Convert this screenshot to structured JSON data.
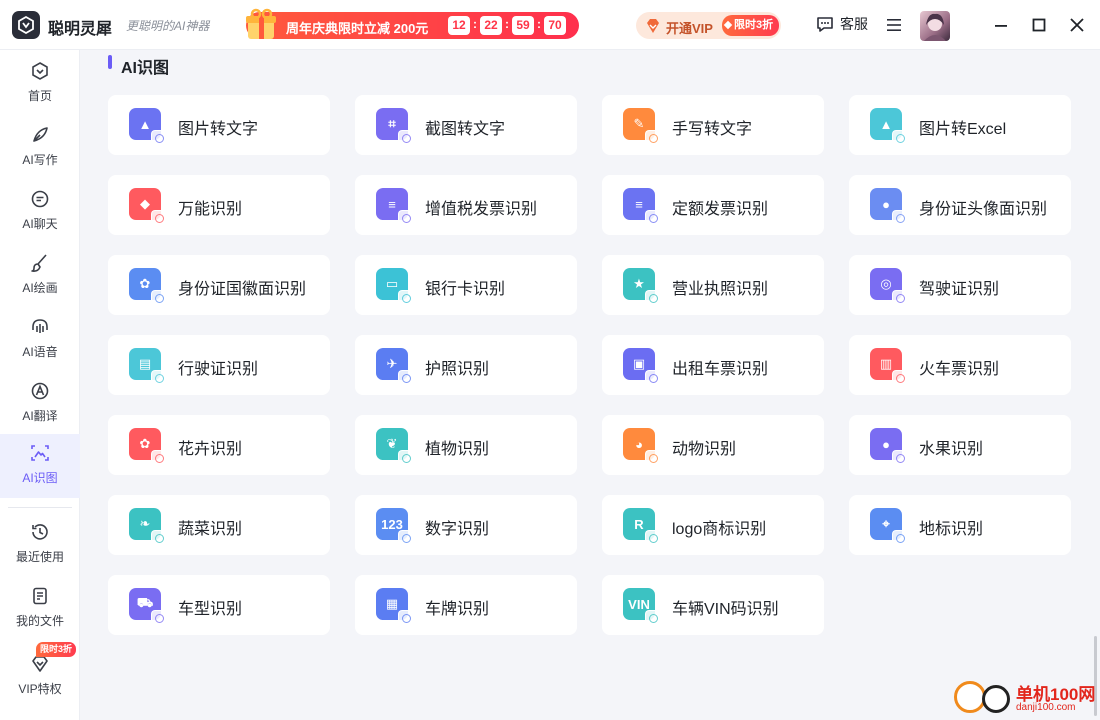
{
  "header": {
    "app_name": "聪明灵犀",
    "slogan": "更聪明的AI神器",
    "promo_text": "周年庆典限时立减 200元",
    "countdown": [
      "12",
      "22",
      "59",
      "70"
    ],
    "vip_label": "开通VIP",
    "vip_badge": "限时3折",
    "service_label": "客服"
  },
  "sidebar": {
    "items": [
      {
        "label": "首页",
        "icon": "home-icon"
      },
      {
        "label": "AI写作",
        "icon": "pen-icon"
      },
      {
        "label": "AI聊天",
        "icon": "chat-icon"
      },
      {
        "label": "AI绘画",
        "icon": "brush-icon"
      },
      {
        "label": "AI语音",
        "icon": "headphones-icon"
      },
      {
        "label": "AI翻译",
        "icon": "translate-icon"
      },
      {
        "label": "AI识图",
        "icon": "image-scan-icon",
        "active": true
      },
      {
        "label": "最近使用",
        "icon": "history-icon"
      },
      {
        "label": "我的文件",
        "icon": "file-icon"
      },
      {
        "label": "VIP特权",
        "icon": "diamond-icon"
      }
    ],
    "vip_badge": "限时3折"
  },
  "main": {
    "section_title": "AI识图",
    "tools": [
      {
        "label": "图片转文字",
        "icon": "image-to-text-icon",
        "color": "#6b73f2",
        "glyph": "▲"
      },
      {
        "label": "截图转文字",
        "icon": "screenshot-to-text-icon",
        "color": "#7a6df2",
        "glyph": "⌗"
      },
      {
        "label": "手写转文字",
        "icon": "handwriting-icon",
        "color": "#ff8a3d",
        "glyph": "✎"
      },
      {
        "label": "图片转Excel",
        "icon": "image-to-excel-icon",
        "color": "#4cc7d8",
        "glyph": "▲"
      },
      {
        "label": "万能识别",
        "icon": "universal-recognition-icon",
        "color": "#ff5a5f",
        "glyph": "◆"
      },
      {
        "label": "增值税发票识别",
        "icon": "vat-invoice-icon",
        "color": "#7a6df2",
        "glyph": "≡"
      },
      {
        "label": "定额发票识别",
        "icon": "quota-invoice-icon",
        "color": "#6b73f2",
        "glyph": "≡"
      },
      {
        "label": "身份证头像面识别",
        "icon": "id-card-photo-icon",
        "color": "#6b8df2",
        "glyph": "●"
      },
      {
        "label": "身份证国徽面识别",
        "icon": "id-card-emblem-icon",
        "color": "#5b8df2",
        "glyph": "✿"
      },
      {
        "label": "银行卡识别",
        "icon": "bank-card-icon",
        "color": "#3cc2d6",
        "glyph": "▭"
      },
      {
        "label": "营业执照识别",
        "icon": "business-license-icon",
        "color": "#3cc2c2",
        "glyph": "★"
      },
      {
        "label": "驾驶证识别",
        "icon": "driver-license-icon",
        "color": "#7a6df2",
        "glyph": "◎"
      },
      {
        "label": "行驶证识别",
        "icon": "vehicle-license-icon",
        "color": "#4cc7d8",
        "glyph": "▤"
      },
      {
        "label": "护照识别",
        "icon": "passport-icon",
        "color": "#5b7df2",
        "glyph": "✈"
      },
      {
        "label": "出租车票识别",
        "icon": "taxi-ticket-icon",
        "color": "#6b6df2",
        "glyph": "▣"
      },
      {
        "label": "火车票识别",
        "icon": "train-ticket-icon",
        "color": "#ff5a5f",
        "glyph": "▥"
      },
      {
        "label": "花卉识别",
        "icon": "flower-icon",
        "color": "#ff5a5f",
        "glyph": "✿"
      },
      {
        "label": "植物识别",
        "icon": "plant-icon",
        "color": "#3cc2c2",
        "glyph": "❦"
      },
      {
        "label": "动物识别",
        "icon": "animal-icon",
        "color": "#ff8a3d",
        "glyph": "◕"
      },
      {
        "label": "水果识别",
        "icon": "fruit-icon",
        "color": "#7a6df2",
        "glyph": "●"
      },
      {
        "label": "蔬菜识别",
        "icon": "vegetable-icon",
        "color": "#3cc2c2",
        "glyph": "❧"
      },
      {
        "label": "数字识别",
        "icon": "number-icon",
        "color": "#5b8df2",
        "glyph": "123"
      },
      {
        "label": "logo商标识别",
        "icon": "logo-trademark-icon",
        "color": "#3cc2c2",
        "glyph": "R"
      },
      {
        "label": "地标识别",
        "icon": "landmark-icon",
        "color": "#5b8df2",
        "glyph": "⌖"
      },
      {
        "label": "车型识别",
        "icon": "car-model-icon",
        "color": "#7a6df2",
        "glyph": "⛟"
      },
      {
        "label": "车牌识别",
        "icon": "license-plate-icon",
        "color": "#5b7df2",
        "glyph": "▦"
      },
      {
        "label": "车辆VIN码识别",
        "icon": "vin-code-icon",
        "color": "#3cc2c2",
        "glyph": "VIN"
      }
    ]
  },
  "watermark": {
    "text": "单机100网",
    "url": "danji100.com"
  }
}
